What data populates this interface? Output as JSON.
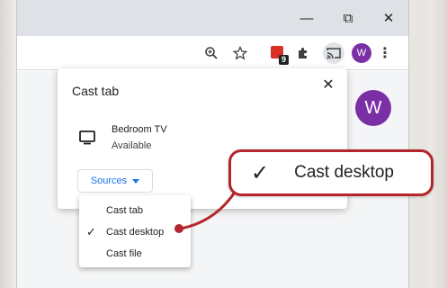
{
  "browser": {
    "window_controls": {
      "minimize": "—",
      "restore": "⧉",
      "close": "✕"
    },
    "toolbar": {
      "zoom_icon": "zoom-in-icon",
      "bookmark_icon": "star-icon",
      "extension_badge": "9",
      "puzzle_icon": "extensions-icon",
      "cast_icon": "cast-icon",
      "avatar_letter": "W",
      "menu_glyph": "⋮"
    },
    "profile_avatar_letter": "W"
  },
  "cast_dialog": {
    "title": "Cast tab",
    "close_glyph": "✕",
    "device": {
      "name": "Bedroom TV",
      "status": "Available"
    },
    "sources_label": "Sources"
  },
  "sources_menu": {
    "items": [
      {
        "label": "Cast tab",
        "checked": false
      },
      {
        "label": "Cast desktop",
        "checked": true
      },
      {
        "label": "Cast file",
        "checked": false
      }
    ],
    "check_glyph": "✓"
  },
  "callout": {
    "check_glyph": "✓",
    "text": "Cast desktop"
  },
  "colors": {
    "accent": "#1a73e8",
    "avatar": "#7b2fa5",
    "callout_border": "#b3262d",
    "extension": "#d93025"
  }
}
